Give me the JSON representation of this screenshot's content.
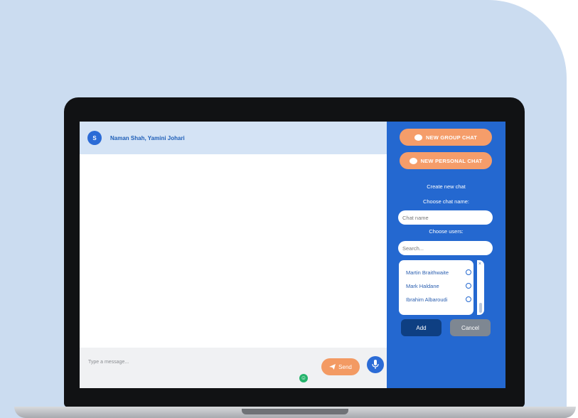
{
  "chat": {
    "avatar_initial": "S",
    "title": "Naman Shah, Yamini Johari",
    "message_placeholder": "Type a message...",
    "send_label": "Send"
  },
  "sidebar": {
    "new_group_label": "NEW GROUP CHAT",
    "new_personal_label": "NEW PERSONAL CHAT",
    "create_heading": "Create new chat",
    "chat_name_label": "Choose chat name:",
    "chat_name_placeholder": "Chat name",
    "users_label": "Choose users:",
    "search_placeholder": "Search...",
    "users": [
      {
        "name": "Martin Braithwaite"
      },
      {
        "name": "Mark Haldane"
      },
      {
        "name": "Ibrahim Albaroudi"
      }
    ],
    "add_label": "Add",
    "cancel_label": "Cancel"
  },
  "colors": {
    "background": "#cbdcf0",
    "sidebar": "#2468d0",
    "accent_orange": "#f59d6a",
    "add_button": "#0e3f82",
    "cancel_button": "#7e8792"
  }
}
